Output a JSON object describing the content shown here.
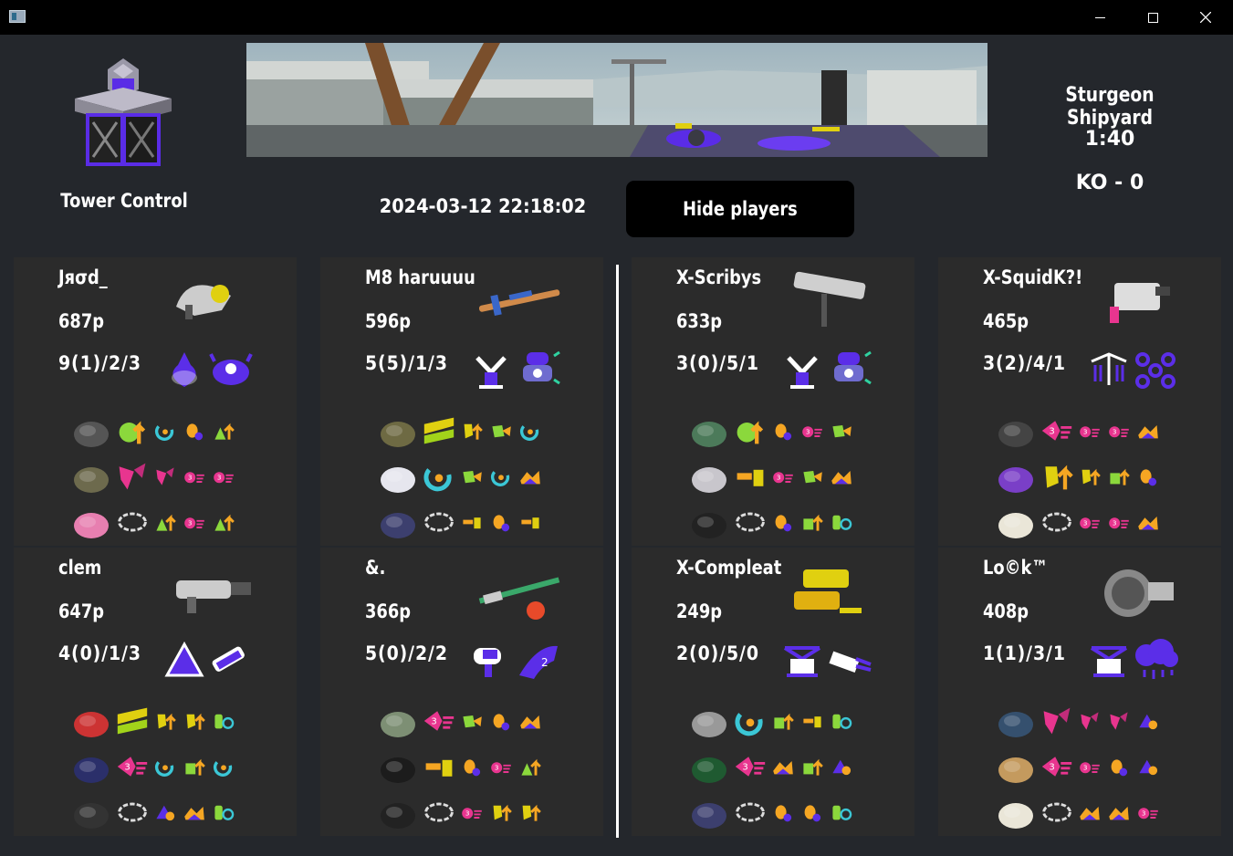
{
  "window": {
    "icons": [
      "app-icon",
      "minimize-icon",
      "maximize-icon",
      "close-icon"
    ]
  },
  "header": {
    "mode": "Tower Control",
    "stage": "Sturgeon Shipyard",
    "timer": "1:40",
    "score": "KO - 0",
    "timestamp": "2024-03-12 22:18:02",
    "hide_players_label": "Hide players"
  },
  "colors": {
    "alpha_team": "#5b2ee8",
    "bravo_team": "#e0d010",
    "background": "#24272c",
    "card": "#2b2b2b",
    "ability_orange": "#f5a623",
    "ability_pink": "#e8358f",
    "ability_green": "#8bd83c"
  },
  "players": [
    {
      "name": "Jяσd_",
      "power": "687p",
      "kda": "9(1)/2/3",
      "weapon": "splatling-weapon",
      "sub": "fizzy-bomb",
      "special": "crab-tank",
      "gear": [
        {
          "item": "headband",
          "main": "ink-saver-main",
          "subs": [
            "quick-respawn",
            "special-charge-up",
            "run-speed-up"
          ]
        },
        {
          "item": "shirt",
          "main": "ink-recovery",
          "subs": [
            "ink-recovery",
            "ink-saver-sub",
            "ink-saver-sub"
          ]
        },
        {
          "item": "pink-shoes",
          "main": "stealth-jump",
          "subs": [
            "run-speed-up",
            "ink-saver-sub",
            "run-speed-up"
          ]
        }
      ]
    },
    {
      "name": "M8 haruuuu",
      "power": "596p",
      "kda": "5(5)/1/3",
      "weapon": "charger-weapon",
      "sub": "sprinkler",
      "special": "ink-vac",
      "gear": [
        {
          "item": "bucket-hat",
          "main": "ninja-squid",
          "subs": [
            "swim-speed-up",
            "special-saver",
            "quick-respawn"
          ]
        },
        {
          "item": "long-sleeve",
          "main": "quick-respawn",
          "subs": [
            "special-saver",
            "quick-respawn",
            "intensify-action"
          ]
        },
        {
          "item": "sneakers",
          "main": "stealth-jump",
          "subs": [
            "comeback",
            "special-charge-up",
            "comeback"
          ]
        }
      ]
    },
    {
      "name": "X-Scribys",
      "power": "633p",
      "kda": "3(0)/5/1",
      "weapon": "brush-weapon",
      "sub": "sprinkler",
      "special": "ink-vac",
      "gear": [
        {
          "item": "glasses",
          "main": "ink-saver-main",
          "subs": [
            "special-charge-up",
            "ink-saver-sub",
            "special-saver"
          ]
        },
        {
          "item": "jacket",
          "main": "comeback",
          "subs": [
            "ink-saver-sub",
            "special-saver",
            "intensify-action"
          ]
        },
        {
          "item": "boots",
          "main": "stealth-jump",
          "subs": [
            "special-charge-up",
            "sub-power-up",
            "sub-resistance"
          ]
        }
      ]
    },
    {
      "name": "X-SquidK?!",
      "power": "465p",
      "kda": "3(2)/4/1",
      "weapon": "blaster-weapon",
      "sub": "ink-mine",
      "special": "triple-splashdown",
      "gear": [
        {
          "item": "sunglasses",
          "main": "quick-super-jump",
          "subs": [
            "ink-saver-sub",
            "ink-saver-sub",
            "intensify-action"
          ]
        },
        {
          "item": "cape-jacket",
          "main": "swim-speed-up",
          "subs": [
            "swim-speed-up",
            "sub-power-up",
            "special-charge-up"
          ]
        },
        {
          "item": "white-shoes",
          "main": "stealth-jump",
          "subs": [
            "ink-saver-sub",
            "ink-saver-sub",
            "intensify-action"
          ]
        }
      ]
    },
    {
      "name": "clem",
      "power": "647p",
      "kda": "4(0)/1/3",
      "weapon": "shooter-weapon",
      "sub": "point-sensor",
      "special": "killer-wail",
      "gear": [
        {
          "item": "cap",
          "main": "ninja-squid",
          "subs": [
            "swim-speed-up",
            "swim-speed-up",
            "sub-resistance"
          ]
        },
        {
          "item": "jersey",
          "main": "quick-super-jump",
          "subs": [
            "quick-respawn",
            "sub-power-up",
            "quick-respawn"
          ]
        },
        {
          "item": "high-tops",
          "main": "stealth-jump",
          "subs": [
            "ink-resistance",
            "intensify-action",
            "sub-resistance"
          ]
        }
      ]
    },
    {
      "name": "&.",
      "power": "366p",
      "kda": "5(0)/2/2",
      "weapon": "splatana-weapon",
      "sub": "torpedo",
      "special": "reefslider",
      "gear": [
        {
          "item": "camo-cap",
          "main": "quick-super-jump",
          "subs": [
            "special-saver",
            "special-charge-up",
            "intensify-action"
          ]
        },
        {
          "item": "tee",
          "main": "comeback",
          "subs": [
            "special-charge-up",
            "ink-saver-sub",
            "run-speed-up"
          ]
        },
        {
          "item": "boots",
          "main": "stealth-jump",
          "subs": [
            "ink-saver-sub",
            "swim-speed-up",
            "swim-speed-up"
          ]
        }
      ]
    },
    {
      "name": "X-Compleat",
      "power": "249p",
      "kda": "2(0)/5/0",
      "weapon": "dualies-weapon",
      "sub": "squid-beakon",
      "special": "tacticooler",
      "gear": [
        {
          "item": "wire-glasses",
          "main": "quick-respawn",
          "subs": [
            "sub-power-up",
            "comeback",
            "sub-resistance"
          ]
        },
        {
          "item": "ugly-sweater",
          "main": "quick-super-jump",
          "subs": [
            "intensify-action",
            "sub-power-up",
            "ink-resistance"
          ]
        },
        {
          "item": "sneakers",
          "main": "stealth-jump",
          "subs": [
            "special-charge-up",
            "special-charge-up",
            "sub-resistance"
          ]
        }
      ]
    },
    {
      "name": "Lo©k™",
      "power": "408p",
      "kda": "1(1)/3/1",
      "weapon": "bucket-weapon",
      "sub": "squid-beakon",
      "special": "ink-storm",
      "gear": [
        {
          "item": "headphones",
          "main": "ink-recovery",
          "subs": [
            "ink-recovery",
            "ink-recovery",
            "ink-resistance"
          ]
        },
        {
          "item": "coat",
          "main": "quick-super-jump",
          "subs": [
            "ink-saver-sub",
            "special-charge-up",
            "ink-resistance"
          ]
        },
        {
          "item": "white-shoes",
          "main": "stealth-jump",
          "subs": [
            "intensify-action",
            "intensify-action",
            "ink-saver-sub"
          ]
        }
      ]
    }
  ]
}
